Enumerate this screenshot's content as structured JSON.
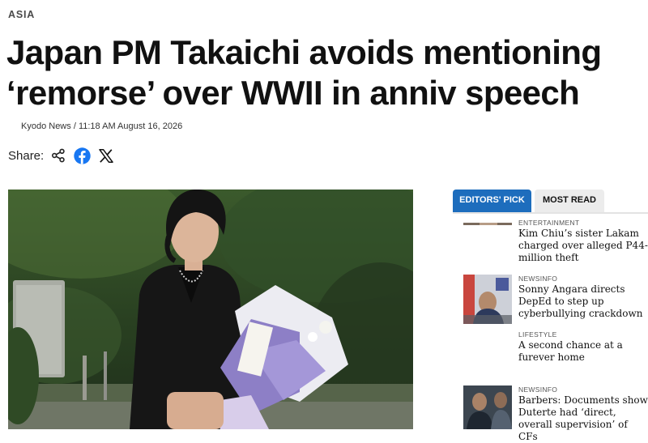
{
  "section": "ASIA",
  "headline": "Japan PM Takaichi avoids mentioning ‘remorse’ over WWII in anniv speech",
  "byline": {
    "source": "Kyodo News",
    "separator": "/",
    "timestamp": "11:18 AM August 16, 2026"
  },
  "share": {
    "label": "Share:",
    "icons": [
      "share-icon",
      "facebook-icon",
      "x-icon"
    ],
    "facebook_color": "#1877f2"
  },
  "sidebar": {
    "tabs": [
      {
        "label": "EDITORS' PICK",
        "active": true
      },
      {
        "label": "MOST READ",
        "active": false
      }
    ],
    "accent": "#1d6dbd",
    "items": [
      {
        "category": "ENTERTAINMENT",
        "title": "Kim Chiu’s sister Lakam charged over alleged P44-million theft"
      },
      {
        "category": "NEWSINFO",
        "title": "Sonny Angara directs DepEd to step up cyberbullying crackdown"
      },
      {
        "category": "LIFESTYLE",
        "title": "A second chance at a furever home"
      },
      {
        "category": "NEWSINFO",
        "title": "Barbers: Documents show Duterte had ‘direct, overall supervision’ of CFs"
      }
    ]
  }
}
